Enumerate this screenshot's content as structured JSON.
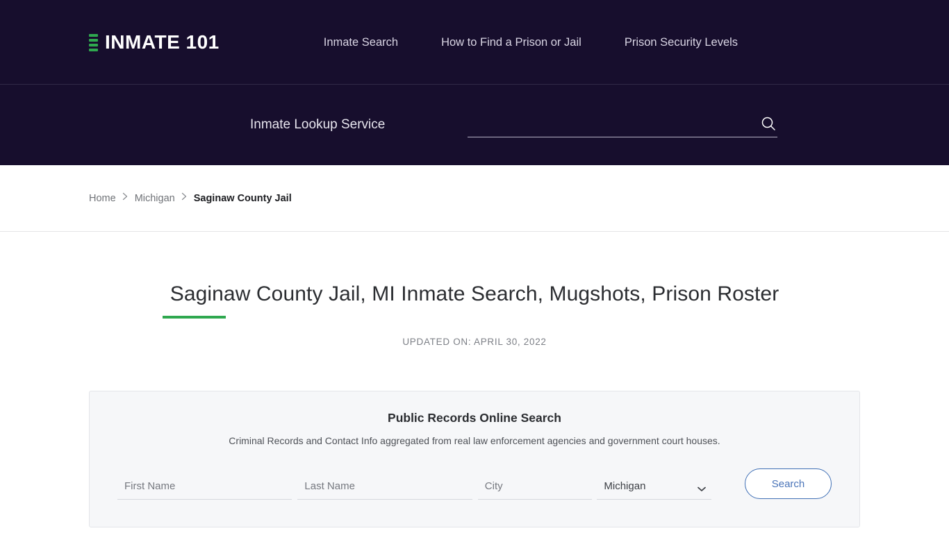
{
  "header": {
    "logo": {
      "text": "INMATE 101",
      "mark_color": "#2fa84f",
      "bars": 4
    },
    "nav": [
      {
        "label": "Inmate Search"
      },
      {
        "label": "How to Find a Prison or Jail"
      },
      {
        "label": "Prison Security Levels"
      }
    ]
  },
  "lookup": {
    "label": "Inmate Lookup Service",
    "search_value": "",
    "search_placeholder": "",
    "search_icon": "search-icon"
  },
  "breadcrumb": {
    "items": [
      {
        "label": "Home",
        "current": false
      },
      {
        "label": "Michigan",
        "current": false
      },
      {
        "label": "Saginaw County Jail",
        "current": true
      }
    ],
    "separator": "›"
  },
  "main": {
    "title": "Saginaw County Jail, MI Inmate Search, Mugshots, Prison Roster",
    "accent_color": "#2fa84f",
    "updated": "UPDATED ON: APRIL 30, 2022"
  },
  "records": {
    "title": "Public Records Online Search",
    "subtitle": "Criminal Records and Contact Info aggregated from real law enforcement agencies and government court houses.",
    "fields": {
      "first_name": {
        "value": "",
        "placeholder": "First Name"
      },
      "last_name": {
        "value": "",
        "placeholder": "Last Name"
      },
      "city": {
        "value": "",
        "placeholder": "City"
      },
      "state": {
        "selected": "Michigan",
        "options": [
          "Michigan"
        ]
      }
    },
    "submit_label": "Search",
    "submit_color": "#4a74b8"
  }
}
